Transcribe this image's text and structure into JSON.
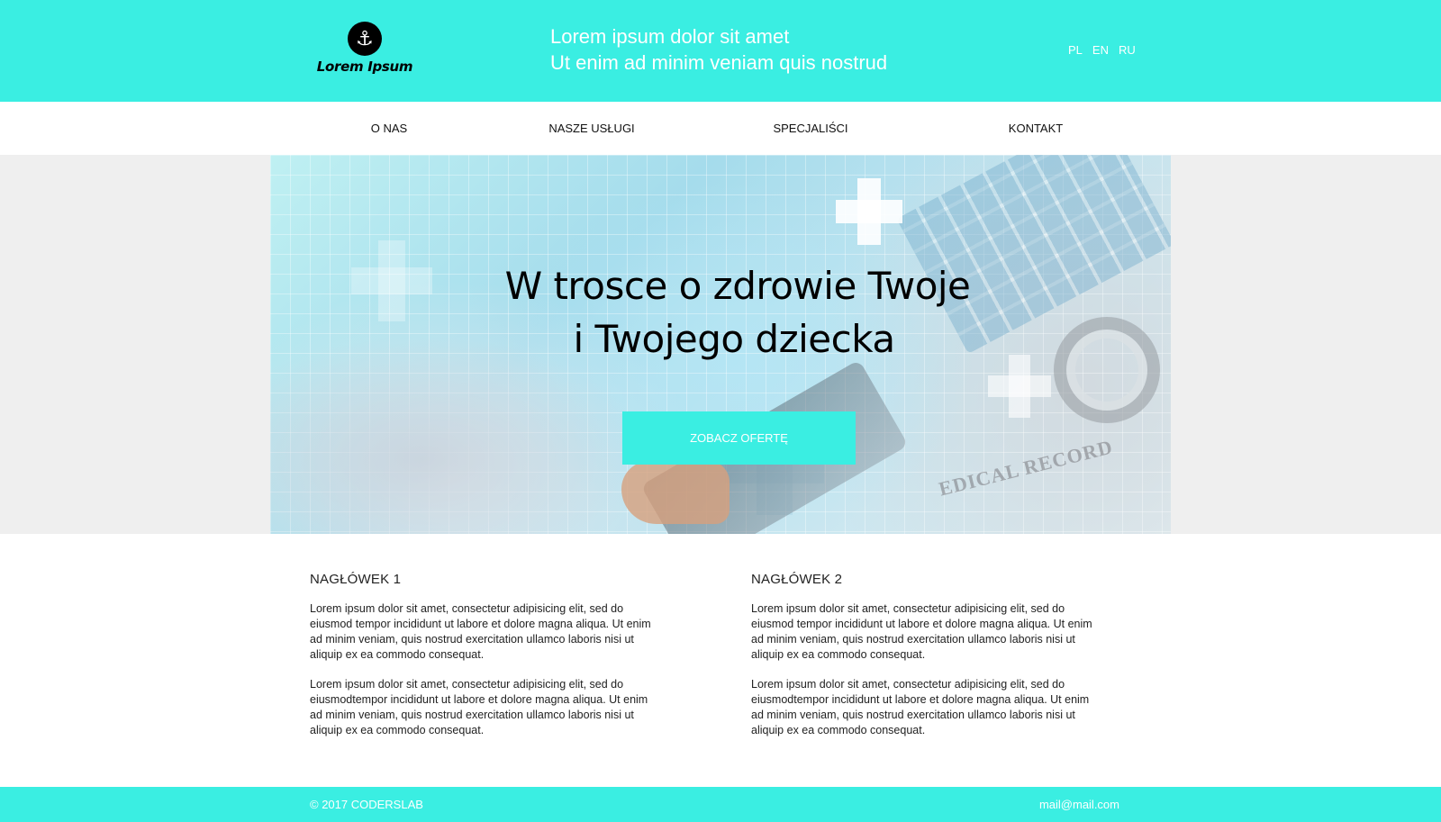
{
  "header": {
    "logo_text": "Lorem Ipsum",
    "logo_icon": "anchor-icon",
    "tagline_line1": "Lorem ipsum dolor sit amet",
    "tagline_line2": "Ut enim ad minim veniam quis nostrud",
    "languages": [
      "PL",
      "EN",
      "RU"
    ]
  },
  "nav": {
    "items": [
      {
        "label": "O NAS"
      },
      {
        "label": "NASZE USŁUGI"
      },
      {
        "label": "SPECJALIŚCI"
      },
      {
        "label": "KONTAKT"
      }
    ]
  },
  "hero": {
    "title_line1": "W trosce o zdrowie Twoje",
    "title_line2": "i Twojego dziecka",
    "cta_label": "ZOBACZ OFERTĘ",
    "image_text": "EDICAL RECORD"
  },
  "content": {
    "columns": [
      {
        "heading": "NAGŁÓWEK 1",
        "paragraphs": [
          "Lorem ipsum dolor sit amet, consectetur adipisicing elit, sed do eiusmod tempor incididunt ut labore et dolore magna aliqua. Ut enim ad minim veniam, quis nostrud exercitation ullamco laboris nisi ut aliquip ex ea commodo consequat.",
          "Lorem ipsum dolor sit amet, consectetur adipisicing elit, sed do eiusmodtempor incididunt ut labore et dolore magna aliqua. Ut enim ad minim veniam, quis nostrud exercitation ullamco laboris nisi ut aliquip ex ea commodo consequat."
        ]
      },
      {
        "heading": "NAGŁÓWEK 2",
        "paragraphs": [
          "Lorem ipsum dolor sit amet, consectetur adipisicing elit, sed do eiusmod tempor incididunt ut labore et dolore magna aliqua. Ut enim ad minim veniam, quis nostrud exercitation ullamco laboris nisi ut aliquip ex ea commodo consequat.",
          "Lorem ipsum dolor sit amet, consectetur adipisicing elit, sed do eiusmodtempor incididunt ut labore et dolore magna aliqua. Ut enim ad minim veniam, quis nostrud exercitation ullamco laboris nisi ut aliquip ex ea commodo consequat."
        ]
      }
    ]
  },
  "footer": {
    "copyright": "© 2017 CODERSLAB",
    "email": "mail@mail.com"
  },
  "colors": {
    "accent": "#3aeee2",
    "hero_band": "#efefef",
    "text": "#222222"
  }
}
